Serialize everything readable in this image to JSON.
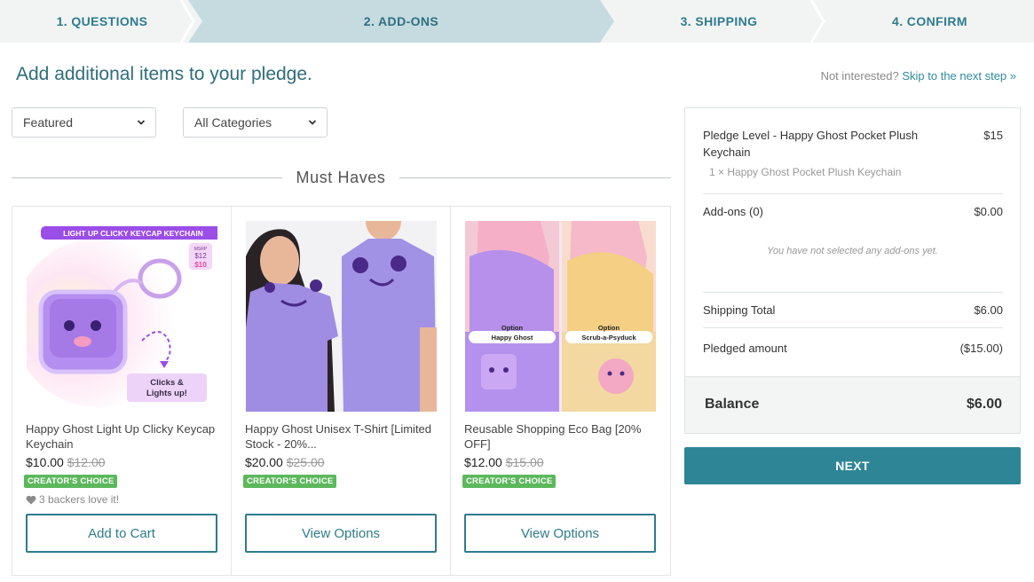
{
  "stepper": {
    "steps": [
      {
        "label": "1. QUESTIONS"
      },
      {
        "label": "2. ADD-ONS"
      },
      {
        "label": "3. SHIPPING"
      },
      {
        "label": "4. CONFIRM"
      }
    ],
    "active_step": 2
  },
  "header": {
    "title": "Add additional items to your pledge.",
    "skip_prefix": "Not interested?",
    "skip_link": "Skip to the next step »"
  },
  "filters": {
    "sort": {
      "selected": "Featured"
    },
    "category": {
      "selected": "All Categories"
    }
  },
  "section": {
    "title": "Must Haves"
  },
  "products": [
    {
      "name": "Happy Ghost Light Up Clicky Keycap Keychain",
      "price": "$10.00",
      "old_price": "$12.00",
      "badge": "CREATOR'S CHOICE",
      "backers": "3 backers love it!",
      "button": "Add to Cart",
      "image": {
        "banner": "LIGHT UP CLICKY KEYCAP KEYCHAIN",
        "msrp_label": "MSRP",
        "msrp_old": "$12",
        "msrp_new": "$10",
        "callout": "Clicks & Lights up!"
      }
    },
    {
      "name": "Happy Ghost Unisex T-Shirt [Limited Stock - 20%...",
      "price": "$20.00",
      "old_price": "$25.00",
      "badge": "CREATOR'S CHOICE",
      "button": "View Options"
    },
    {
      "name": "Reusable Shopping Eco Bag [20% OFF]",
      "price": "$12.00",
      "old_price": "$15.00",
      "badge": "CREATOR'S CHOICE",
      "button": "View Options",
      "image": {
        "option_word": "Option",
        "option_left": "Happy Ghost",
        "option_right": "Scrub-a-Psyduck"
      }
    }
  ],
  "summary": {
    "pledge_label": "Pledge Level - Happy Ghost Pocket Plush Keychain",
    "pledge_value": "$15",
    "pledge_item": "1 × Happy Ghost Pocket Plush Keychain",
    "addons_label": "Add-ons (0)",
    "addons_value": "$0.00",
    "addons_empty": "You have not selected any add-ons yet.",
    "shipping_label": "Shipping Total",
    "shipping_value": "$6.00",
    "pledged_label": "Pledged amount",
    "pledged_value": "($15.00)",
    "balance_label": "Balance",
    "balance_value": "$6.00"
  },
  "next_button": "NEXT",
  "colors": {
    "accent": "#2e8596",
    "active_step_bg": "#c5dbe0",
    "badge_green": "#5cb85c"
  }
}
